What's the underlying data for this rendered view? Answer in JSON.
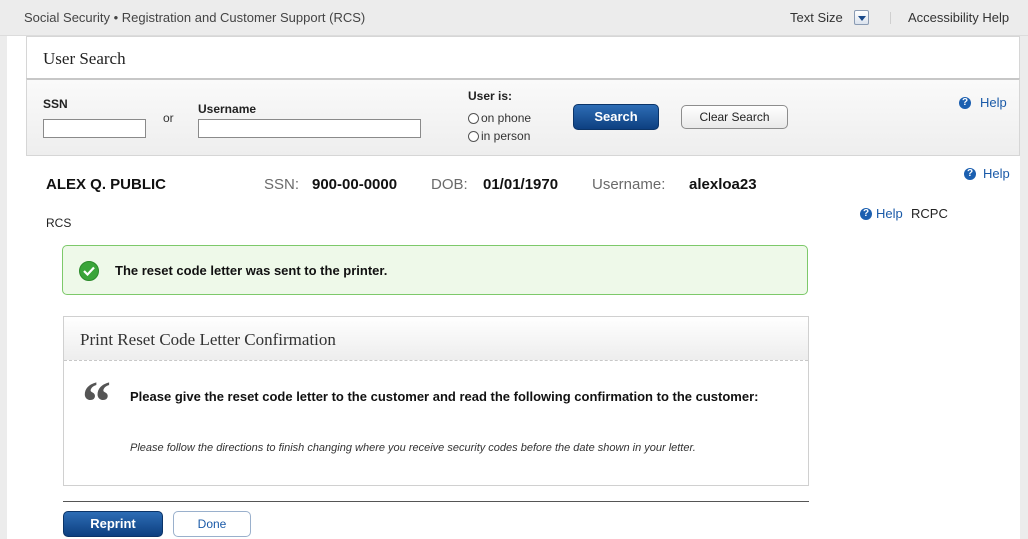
{
  "top_bar": {
    "app_title": "Social Security • Registration and Customer Support (RCS)",
    "text_size_label": "Text Size",
    "accessibility_help": "Accessibility Help"
  },
  "user_search": {
    "title": "User Search",
    "ssn_label": "SSN",
    "or_label": "or",
    "username_label": "Username",
    "ssn_value": "",
    "username_value": "",
    "user_is_label": "User is:",
    "radio_on_phone": "on phone",
    "radio_in_person": "in person",
    "search_button": "Search",
    "clear_button": "Clear Search",
    "help": "Help"
  },
  "user_info": {
    "name": "ALEX Q. PUBLIC",
    "ssn_label": "SSN:",
    "ssn_value": "900-00-0000",
    "dob_label": "DOB:",
    "dob_value": "01/01/1970",
    "username_label": "Username:",
    "username_value": "alexloa23",
    "help": "Help",
    "rcs": "RCS",
    "rcpc_help": "Help",
    "rcpc": "RCPC"
  },
  "success": {
    "message": "The reset code letter was sent to the printer."
  },
  "confirmation": {
    "title": "Print Reset Code Letter Confirmation",
    "quote_mark": "“",
    "instruction": "Please give the reset code letter to the customer and read the following confirmation to the customer:",
    "text": "Please follow the directions to finish changing where you receive security codes before the date shown in your letter."
  },
  "actions": {
    "reprint": "Reprint",
    "done": "Done"
  }
}
